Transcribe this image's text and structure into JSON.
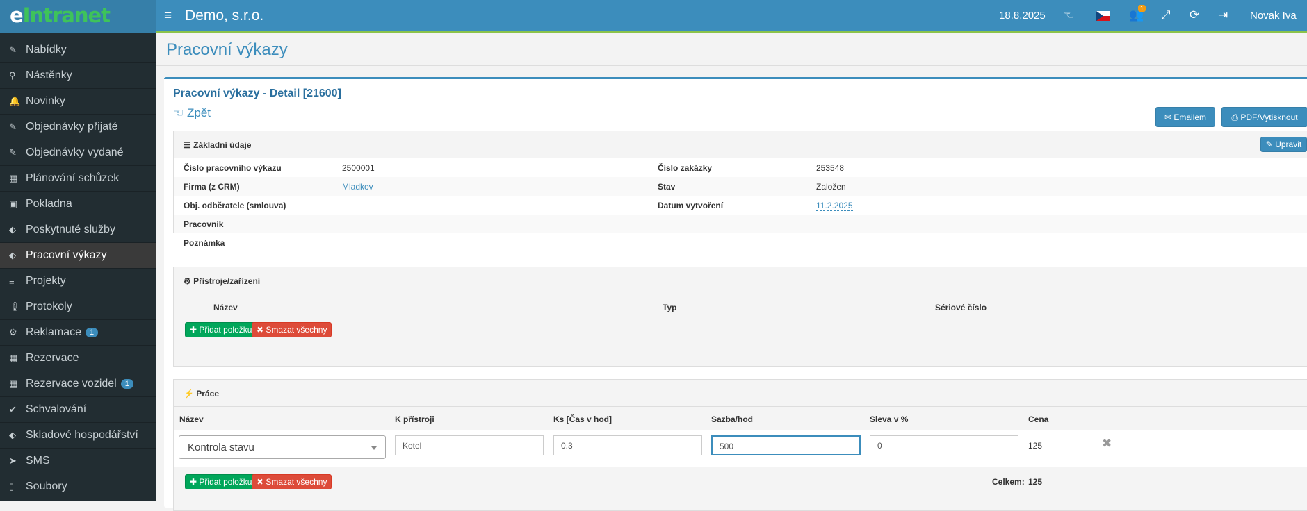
{
  "app": {
    "logo_e": "e",
    "logo_rest": "Intranet",
    "company": "Demo, s.r.o.",
    "date": "18.8.2025",
    "user": "Novak Iva",
    "notif_count": "1"
  },
  "icons": {
    "menu": "hamburger-icon",
    "share": "hand-point-icon",
    "flag": "czech-flag-icon",
    "users": "users-icon",
    "fullscreen": "expand-icon",
    "refresh": "refresh-icon",
    "logout": "sign-out-icon"
  },
  "sidebar": {
    "items": [
      {
        "label": "Nabídky",
        "icon": "✎"
      },
      {
        "label": "Nástěnky",
        "icon": "⚲"
      },
      {
        "label": "Novinky",
        "icon": "🔔"
      },
      {
        "label": "Objednávky přijaté",
        "icon": "✎"
      },
      {
        "label": "Objednávky vydané",
        "icon": "✎"
      },
      {
        "label": "Plánování schůzek",
        "icon": "▦"
      },
      {
        "label": "Pokladna",
        "icon": "▣"
      },
      {
        "label": "Poskytnuté služby",
        "icon": "⬖"
      },
      {
        "label": "Pracovní výkazy",
        "icon": "⬖",
        "active": true
      },
      {
        "label": "Projekty",
        "icon": "≡"
      },
      {
        "label": "Protokoly",
        "icon": "🌡"
      },
      {
        "label": "Reklamace",
        "icon": "⚙",
        "badge": "1"
      },
      {
        "label": "Rezervace",
        "icon": "▦"
      },
      {
        "label": "Rezervace vozidel",
        "icon": "▦",
        "badge": "1"
      },
      {
        "label": "Schvalování",
        "icon": "✔"
      },
      {
        "label": "Skladové hospodářství",
        "icon": "⬖"
      },
      {
        "label": "SMS",
        "icon": "➤"
      },
      {
        "label": "Soubory",
        "icon": "▯"
      }
    ]
  },
  "page": {
    "title": "Pracovní výkazy",
    "detail_title": "Pracovní výkazy - Detail [21600]",
    "back": "Zpět",
    "email_btn": "Emailem",
    "pdf_btn": "PDF/Vytisknout"
  },
  "basic": {
    "heading": "Základní údaje",
    "edit_btn": "Upravit",
    "left": [
      {
        "label": "Číslo pracovního výkazu",
        "value": "2500001"
      },
      {
        "label": "Firma (z CRM)",
        "value": "Mladkov"
      },
      {
        "label": "Obj. odběratele (smlouva)",
        "value": ""
      },
      {
        "label": "Pracovník",
        "value": ""
      },
      {
        "label": "Poznámka",
        "value": ""
      }
    ],
    "right": [
      {
        "label": "Číslo zakázky",
        "value": "253548"
      },
      {
        "label": "Stav",
        "value": "Založen"
      },
      {
        "label": "Datum vytvoření",
        "value": "11.2.2025"
      }
    ]
  },
  "devices": {
    "heading": "Přístroje/zařízení",
    "col_name": "Název",
    "col_type": "Typ",
    "col_serial": "Sériové číslo",
    "add_btn": "Přidat položku",
    "del_btn": "Smazat všechny"
  },
  "work": {
    "heading": "Práce",
    "cols": [
      "Název",
      "K přístroji",
      "Ks [Čas v hod]",
      "Sazba/hod",
      "Sleva v %",
      "Cena"
    ],
    "row": {
      "name": "Kontrola stavu",
      "device": "Kotel",
      "qty": "0.3",
      "rate": "500",
      "discount": "0",
      "price": "125"
    },
    "add_btn": "Přidat položku",
    "del_btn": "Smazat všechny",
    "total_label": "Celkem:",
    "total": "125"
  }
}
